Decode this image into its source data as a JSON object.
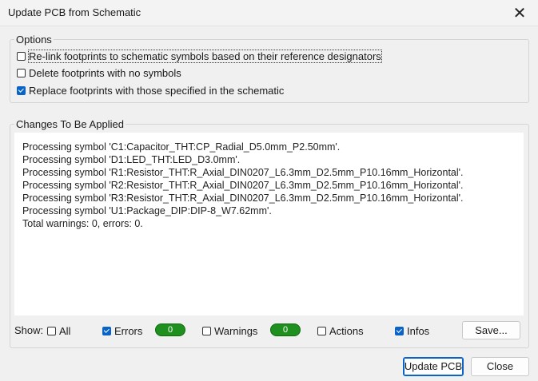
{
  "window": {
    "title": "Update PCB from Schematic",
    "close_glyph": "✕"
  },
  "options": {
    "title": "Options",
    "items": [
      {
        "label": "Re-link footprints to schematic symbols based on their reference designators",
        "checked": false
      },
      {
        "label": "Delete footprints with no symbols",
        "checked": false
      },
      {
        "label": "Replace footprints with those specified in the schematic",
        "checked": true
      }
    ]
  },
  "changes": {
    "title": "Changes To Be Applied",
    "lines": [
      "Processing symbol 'C1:Capacitor_THT:CP_Radial_D5.0mm_P2.50mm'.",
      "Processing symbol 'D1:LED_THT:LED_D3.0mm'.",
      "Processing symbol 'R1:Resistor_THT:R_Axial_DIN0207_L6.3mm_D2.5mm_P10.16mm_Horizontal'.",
      "Processing symbol 'R2:Resistor_THT:R_Axial_DIN0207_L6.3mm_D2.5mm_P10.16mm_Horizontal'.",
      "Processing symbol 'R3:Resistor_THT:R_Axial_DIN0207_L6.3mm_D2.5mm_P10.16mm_Horizontal'.",
      "Processing symbol 'U1:Package_DIP:DIP-8_W7.62mm'.",
      "Total warnings: 0, errors: 0."
    ]
  },
  "filters": {
    "show_label": "Show:",
    "all": {
      "label": "All",
      "checked": false
    },
    "errors": {
      "label": "Errors",
      "checked": true,
      "count": "0"
    },
    "warnings": {
      "label": "Warnings",
      "checked": false,
      "count": "0"
    },
    "actions": {
      "label": "Actions",
      "checked": false
    },
    "infos": {
      "label": "Infos",
      "checked": true
    },
    "save_label": "Save..."
  },
  "buttons": {
    "update_pcb": "Update PCB",
    "close": "Close"
  },
  "colors": {
    "accent": "#0a64c8",
    "badge_green": "#1f8f1f"
  }
}
